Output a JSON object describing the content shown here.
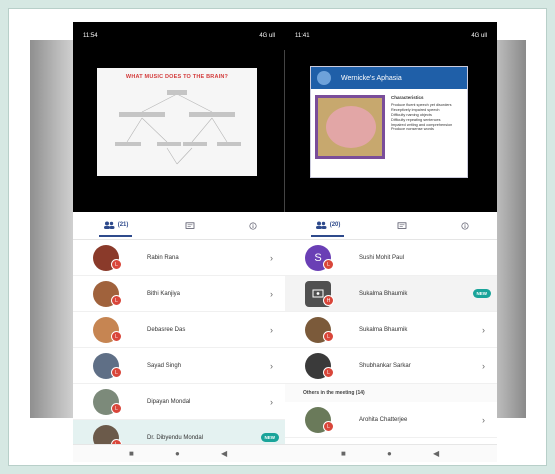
{
  "left_phone": {
    "status_time": "11:54",
    "status_right": "4G ull",
    "slide_title": "WHAT MUSIC DOES TO THE BRAIN?",
    "tab_count": "(21)",
    "participants": [
      {
        "name": "Rabin Rana",
        "badge": "L",
        "avatar_color": "#8a3a2a"
      },
      {
        "name": "Bithi Kanjiya",
        "badge": "L",
        "avatar_color": "#a0623c"
      },
      {
        "name": "Debasree Das",
        "badge": "L",
        "avatar_color": "#c68552"
      },
      {
        "name": "Sayad Singh",
        "badge": "L",
        "avatar_color": "#5f6f86"
      },
      {
        "name": "Dipayan Mondal",
        "badge": "L",
        "avatar_color": "#7c8a7a"
      },
      {
        "name": "Dr. Dibyendu Mondal",
        "badge": "L",
        "avatar_color": "#6b5a4a",
        "new": "NEW"
      }
    ]
  },
  "right_phone": {
    "status_time": "11:41",
    "status_right": "4G ull",
    "slide_title": "Wernicke's Aphasia",
    "slide_heading": "Characteristics",
    "slide_points": [
      "Produce fluent speech yet disorders",
      "Receptively impaired speech",
      "Difficulty naming objects",
      "Difficulty repeating sentences",
      "Impaired writing and comprehension",
      "Produce nonsense words"
    ],
    "tab_count": "(20)",
    "participants": [
      {
        "name": "Sushi Mohit Paul",
        "badge": "L",
        "avatar_letter": "S",
        "avatar_color": "#6a3fb5"
      },
      {
        "name": "Sukalma Bhaumik",
        "badge": "H",
        "avatar_color": "#505050",
        "new": "NEW"
      },
      {
        "name": "Sukalma Bhaumik",
        "badge": "L",
        "avatar_color": "#7b5a3a"
      },
      {
        "name": "Shubhankar Sarkar",
        "badge": "L",
        "avatar_color": "#3a3a3a"
      }
    ],
    "section_label": "Others in the meeting (14)",
    "others": [
      {
        "name": "Arohita Chatterjee",
        "badge": "L",
        "avatar_color": "#6a7a5a"
      }
    ]
  },
  "nav": {
    "square": "■",
    "circle": "●",
    "back": "◀"
  }
}
